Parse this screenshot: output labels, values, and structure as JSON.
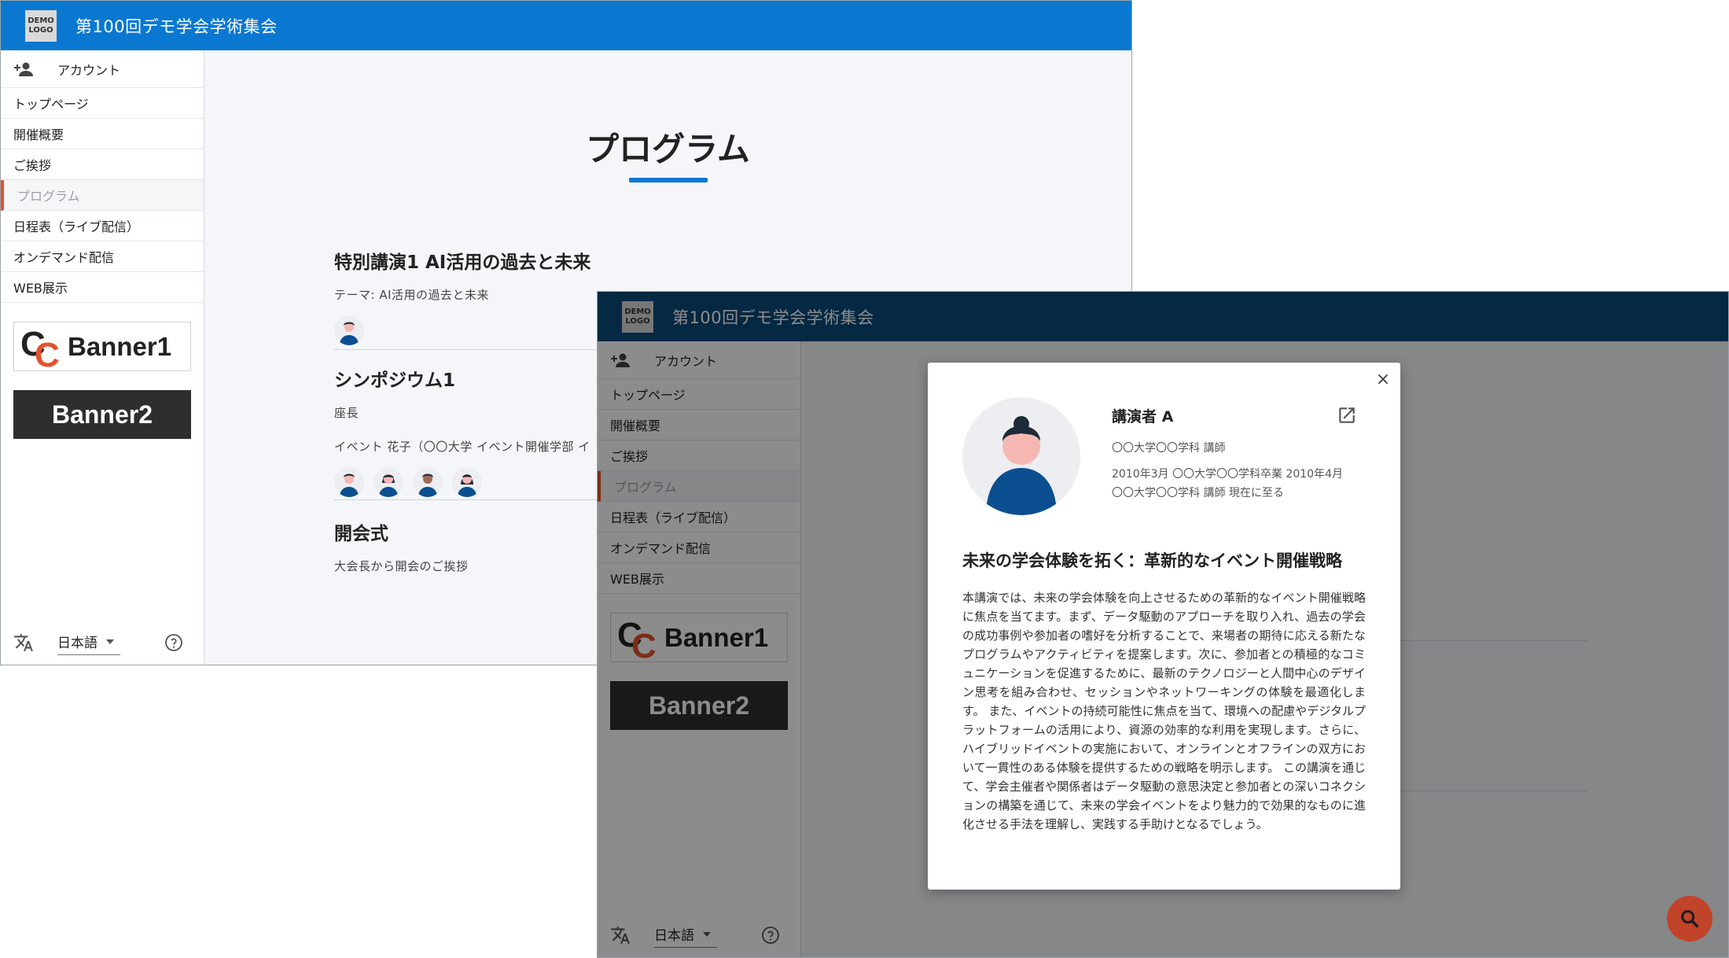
{
  "app": {
    "logo_text": "DEMO\nLOGO",
    "title": "第100回デモ学会学術集会"
  },
  "sidebar": {
    "account_label": "アカウント",
    "items": [
      {
        "label": "トップページ",
        "active": false
      },
      {
        "label": "開催概要",
        "active": false
      },
      {
        "label": "ご挨拶",
        "active": false
      },
      {
        "label": "プログラム",
        "active": true
      },
      {
        "label": "日程表（ライブ配信）",
        "active": false
      },
      {
        "label": "オンデマンド配信",
        "active": false
      },
      {
        "label": "WEB展示",
        "active": false
      }
    ],
    "banner1": "Banner1",
    "banner1_mark": "CC",
    "banner2": "Banner2",
    "language": "日本語"
  },
  "program": {
    "page_title": "プログラム",
    "sessions": [
      {
        "title": "特別講演1 AI活用の過去と未来",
        "subtitle": "テーマ: AI活用の過去と未来",
        "avatars": 1
      },
      {
        "title": "シンポジウム1",
        "chair_label": "座長",
        "chair_line": "イベント 花子（〇〇大学 イベント開催学部 イ",
        "avatars": 4
      },
      {
        "title": "開会式",
        "subtitle": "大会長から開会のご挨拶"
      }
    ]
  },
  "modal": {
    "speaker_name": "講演者 A",
    "affiliation": "〇〇大学〇〇学科 講師",
    "career_line1": "2010年3月 〇〇大学〇〇学科卒業  2010年4月",
    "career_line2": "〇〇大学〇〇学科 講師  現在に至る",
    "lecture_title": "未来の学会体験を拓く：革新的なイベント開催戦略",
    "lecture_body": "本講演では、未来の学会体験を向上させるための革新的なイベント開催戦略に焦点を当てます。まず、データ駆動のアプローチを取り入れ、過去の学会の成功事例や参加者の嗜好を分析することで、来場者の期待に応える新たなプログラムやアクティビティを提案します。次に、参加者との積極的なコミュニケーションを促進するために、最新のテクノロジーと人間中心のデザイン思考を組み合わせ、セッションやネットワーキングの体験を最適化します。 また、イベントの持続可能性に焦点を当て、環境への配慮やデジタルプラットフォームの活用により、資源の効率的な利用を実現します。さらに、ハイブリッドイベントの実施において、オンラインとオフラインの双方において一貫性のある体験を提供するための戦略を明示します。 この講演を通じて、学会主催者や関係者はデータ駆動の意思決定と参加者との深いコネクションの構築を通じて、未来の学会イベントをより魅力的で効果的なものに進化させる手法を理解し、実践する手助けとなるでしょう。",
    "close_glyph": "×"
  },
  "colors": {
    "header_primary": "#0a78d1",
    "header_dimmed": "#0a4a7a",
    "accent": "#e2522c",
    "fab": "#c0432a"
  },
  "icons": [
    "person-add-icon",
    "translate-icon",
    "help-icon",
    "close-icon",
    "external-link-icon",
    "search-icon"
  ]
}
